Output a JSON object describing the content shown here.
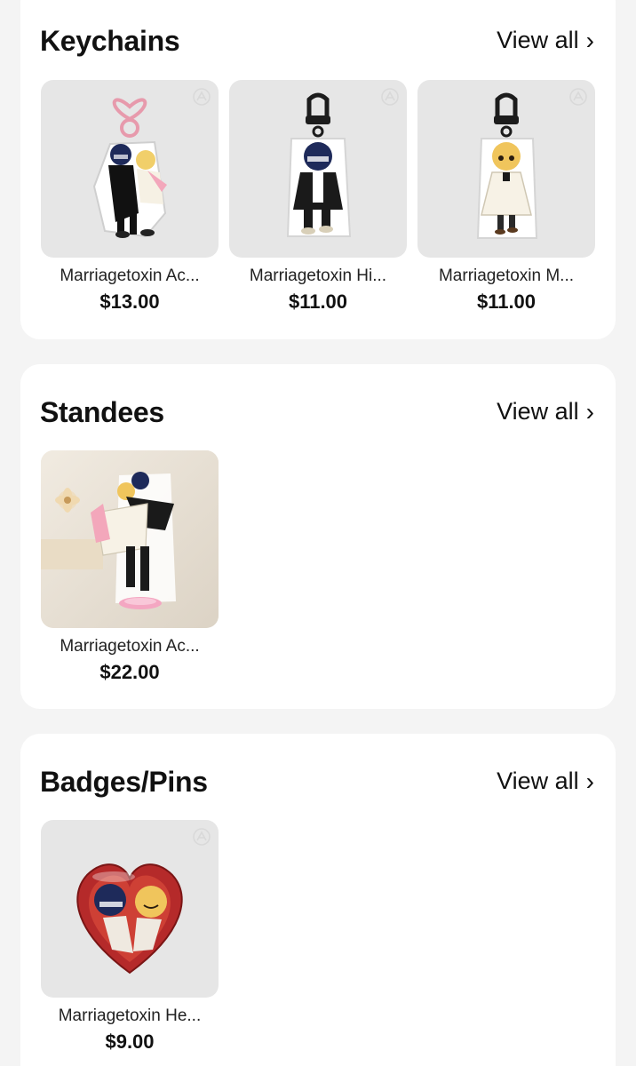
{
  "sections": [
    {
      "title": "Keychains",
      "view_all": "View all",
      "chevron": "›",
      "products": [
        {
          "name": "Marriagetoxin Ac...",
          "price": "$13.00"
        },
        {
          "name": "Marriagetoxin Hi...",
          "price": "$11.00"
        },
        {
          "name": "Marriagetoxin M...",
          "price": "$11.00"
        }
      ]
    },
    {
      "title": "Standees",
      "view_all": "View all",
      "chevron": "›",
      "products": [
        {
          "name": "Marriagetoxin Ac...",
          "price": "$22.00"
        }
      ]
    },
    {
      "title": "Badges/Pins",
      "view_all": "View all",
      "chevron": "›",
      "products": [
        {
          "name": "Marriagetoxin He...",
          "price": "$9.00"
        }
      ]
    }
  ],
  "icons": {
    "view_all_chevron": "chevron-right-icon",
    "watermark": "brand-watermark-icon"
  }
}
